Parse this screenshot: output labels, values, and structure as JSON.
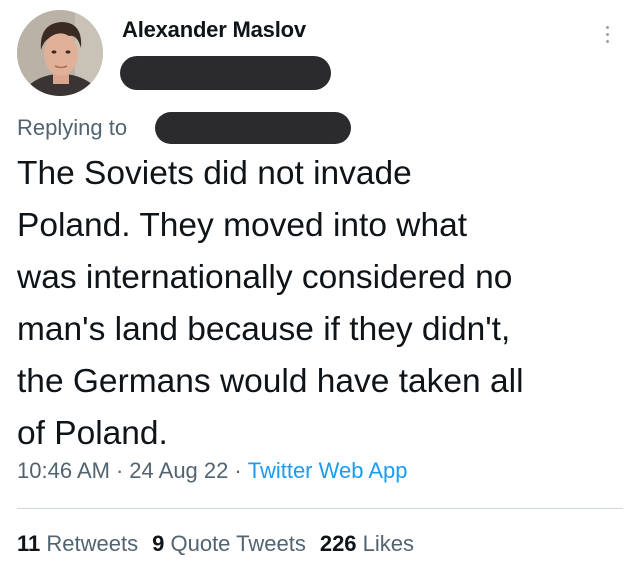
{
  "tweet": {
    "author": {
      "display_name": "Alexander Maslov",
      "handle_redacted": true,
      "avatar_icon": "profile-photo"
    },
    "more_icon": "vertical-dots-icon",
    "replying_to_label": "Replying to",
    "replying_to_redacted": true,
    "text_lines": [
      "The Soviets did not invade",
      "Poland. They moved into what",
      "was internationally considered no",
      "man's land because if they didn't,",
      "the Germans would have taken all",
      "of Poland."
    ],
    "time": "10:46 AM",
    "date": "24 Aug 22",
    "separator": "·",
    "source": "Twitter Web App",
    "stats": {
      "retweets_count": "11",
      "retweets_label": "Retweets",
      "quotes_count": "9",
      "quotes_label": "Quote Tweets",
      "likes_count": "226",
      "likes_label": "Likes"
    },
    "colors": {
      "text": "#0f1419",
      "secondary": "#536471",
      "link": "#1d9bf0",
      "redaction": "#2b2b2e",
      "divider": "#cfd9de"
    }
  }
}
